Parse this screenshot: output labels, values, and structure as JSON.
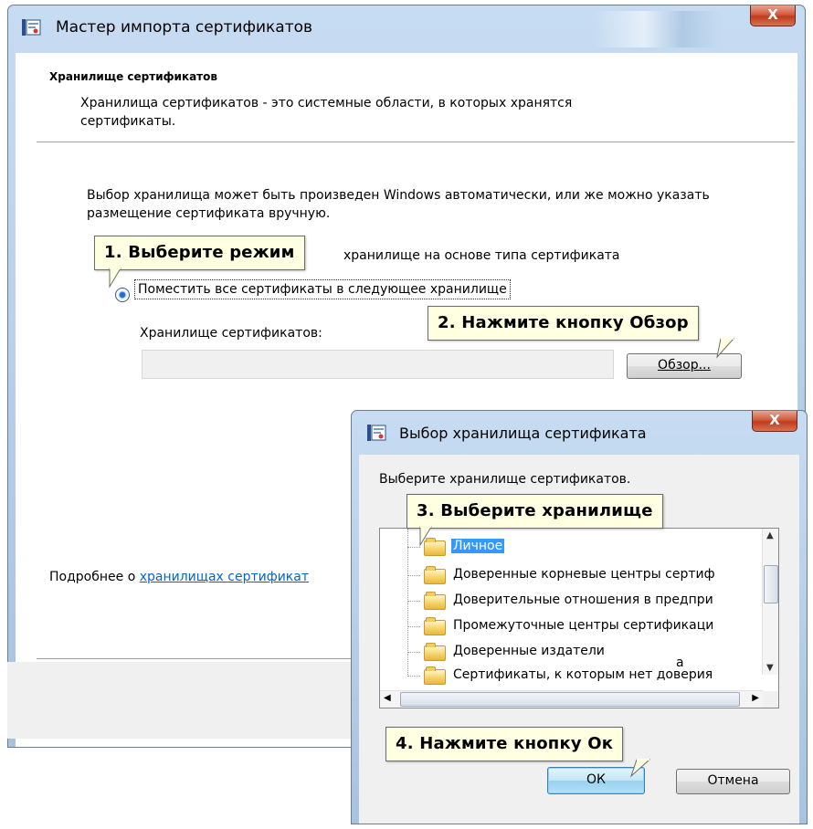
{
  "wizard": {
    "title": "Мастер импорта сертификатов",
    "close_label": "X",
    "header_title": "Хранилище сертификатов",
    "header_desc": "Хранилища сертификатов - это системные области, в которых хранятся сертификаты.",
    "intro": "Выбор хранилища может быть произведен Windows автоматически, или же можно указать размещение сертификата вручную.",
    "option_auto_partial": "хранилище на основе типа сертификата",
    "option_manual": "Поместить все сертификаты в следующее хранилище",
    "store_label": "Хранилище сертификатов:",
    "store_value": "",
    "browse_button": "Обзор...",
    "more_info_prefix": "Подробнее о ",
    "more_info_link": "хранилищах сертификат"
  },
  "dialog": {
    "title": "Выбор хранилища сертификата",
    "close_label": "X",
    "prompt": "Выберите хранилище сертификатов.",
    "stores": [
      "Личное",
      "Доверенные корневые центры сертиф",
      "Доверительные отношения в предпри",
      "Промежуточные центры сертификаци",
      "Доверенные издатели",
      "Сертификаты, к которым нет доверия"
    ],
    "selected_store": "Личное",
    "show_physical_partial": "а",
    "ok_button": "ОК",
    "cancel_button": "Отмена"
  },
  "callouts": {
    "step1": "1. Выберите режим",
    "step2": "2. Нажмите кнопку Обзор",
    "step3": "3. Выберите хранилище",
    "step4": "4. Нажмите кнопку Ок"
  },
  "colors": {
    "callout_bg": "#ffffe1",
    "selection": "#3399ff",
    "link": "#0066cc",
    "close_button": "#c9482a"
  }
}
